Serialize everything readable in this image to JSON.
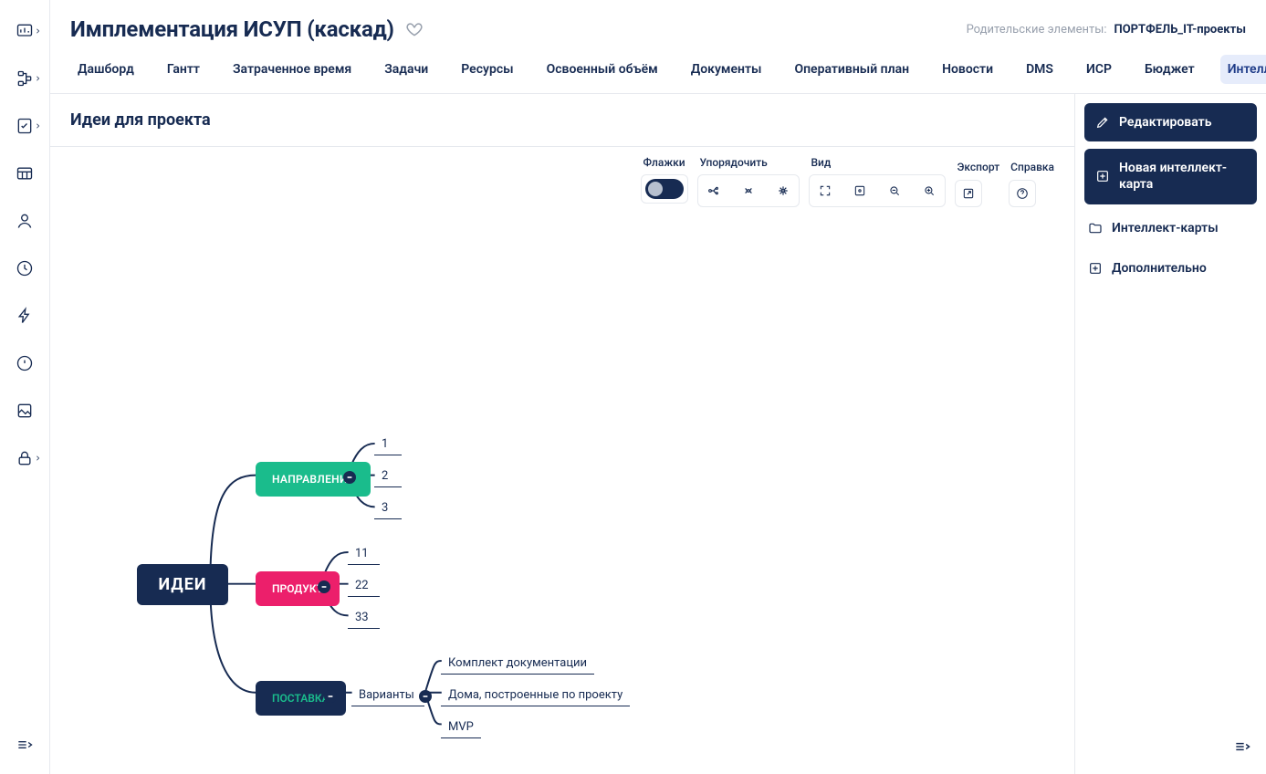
{
  "header": {
    "title": "Имплементация ИСУП (каскад)",
    "parent_label": "Родительские элементы:",
    "parent_value": "ПОРТФЕЛЬ_IT-проекты"
  },
  "tabs": [
    "Дашборд",
    "Гантт",
    "Затраченное время",
    "Задачи",
    "Ресурсы",
    "Освоенный объём",
    "Документы",
    "Оперативный план",
    "Новости",
    "DMS",
    "ИСР",
    "Бюджет",
    "Интеллект-карты"
  ],
  "active_tab_index": 12,
  "section_title": "Идеи для проекта",
  "toolbar": {
    "flags": "Флажки",
    "arrange": "Упорядочить",
    "view": "Вид",
    "export": "Экспорт",
    "help": "Справка"
  },
  "mindmap": {
    "root": "ИДЕИ",
    "branch1": {
      "label": "НАПРАВЛЕНИЯ",
      "leaves": [
        "1",
        "2",
        "3"
      ]
    },
    "branch2": {
      "label": "ПРОДУКТ",
      "leaves": [
        "11",
        "22",
        "33"
      ]
    },
    "branch3": {
      "label": "ПОСТАВКА",
      "sub": "Варианты",
      "leaves": [
        "Комплект документации",
        "Дома, построенные по проекту",
        "MVP"
      ]
    }
  },
  "rightpanel": {
    "edit": "Редактировать",
    "new_map": "Новая интеллект-карта",
    "maps": "Интеллект-карты",
    "more": "Дополнительно"
  }
}
